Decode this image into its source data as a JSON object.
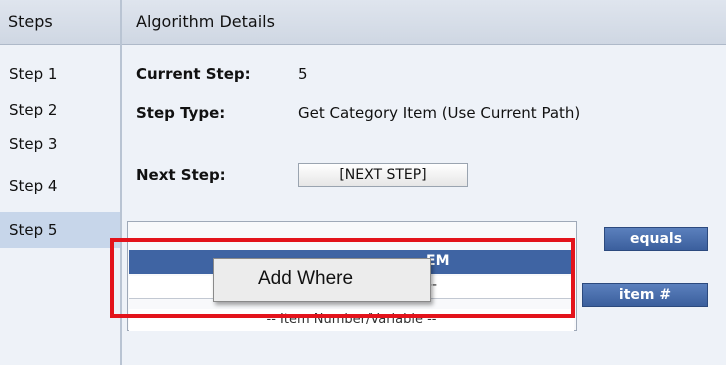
{
  "steps_panel": {
    "title": "Steps",
    "items": [
      {
        "label": "Step 1"
      },
      {
        "label": "Step 2"
      },
      {
        "label": "Step 3"
      },
      {
        "label": "Step 4"
      },
      {
        "label": "Step 5"
      }
    ],
    "selected_index": 4
  },
  "details_panel": {
    "title": "Algorithm Details",
    "current_step_label": "Current Step:",
    "current_step_value": "5",
    "step_type_label": "Step Type:",
    "step_type_value": "Get Category Item (Use Current Path)",
    "next_step_label": "Next Step:",
    "next_step_button": "[NEXT STEP]"
  },
  "where_builder": {
    "selected_row_text": "EM",
    "second_row_text": "--",
    "footer_text": "-- Item Number/Variable --",
    "equals_button": "equals",
    "item_number_button": "item #"
  },
  "context_menu": {
    "items": [
      {
        "label": "Add Where"
      }
    ]
  },
  "colors": {
    "selected_row": "#3f64a3",
    "highlight": "#e3131b",
    "panel_bg": "#eef2f8"
  }
}
